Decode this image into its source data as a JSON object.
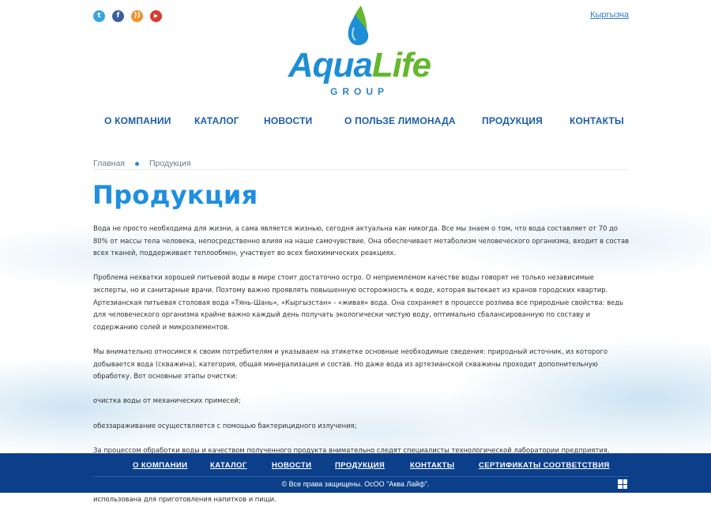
{
  "social": {
    "twitter": {
      "icon": "twitter-icon",
      "glyph": "t"
    },
    "facebook": {
      "icon": "facebook-icon",
      "glyph": "f"
    },
    "rss": {
      "icon": "rss-icon",
      "glyph": "))"
    },
    "youtube": {
      "icon": "youtube-icon",
      "glyph": "▶"
    }
  },
  "language_link": "Кыргызча",
  "logo": {
    "aqua": "Aqua",
    "life": "Life",
    "group": "GROUP"
  },
  "nav": [
    "О КОМПАНИИ",
    "КАТАЛОГ",
    "НОВОСТИ",
    "О ПОЛЬЗЕ ЛИМОНАДА",
    "ПРОДУКЦИЯ",
    "КОНТАКТЫ"
  ],
  "breadcrumb": {
    "home": "Главная",
    "current": "Продукция"
  },
  "page_title": "Продукция",
  "paragraphs": [
    "Вода не просто необходима для жизни, а сама является жизнью, сегодня актуальна как никогда. Все мы знаем о том, что вода составляет от 70 до 80% от массы тела человека, непосредственно влияя на наше самочувствие. Она обеспечивает метаболизм человеческого организма, входит в состав всех тканей, поддерживает теплообмен, участвует во всех биохимических реакциях.",
    "Проблема нехватки хорошей питьевой воды в мире стоит достаточно остро. О неприемлемом качестве воды говорят не только независимые эксперты, но и санитарные врачи. Поэтому важно проявлять повышенную осторожность к воде, которая вытекает из кранов городских квартир. Артезианская питьевая столовая вода «Тянь-Шань», «Кыргызстан» - «живая» вода. Она сохраняет в процессе розлива все природные свойства: ведь для человеческого организма крайне важно каждый день получать экологически чистую воду, оптимально сбалансированную по составу и содержанию солей и микроэлементов.",
    "Мы внимательно относимся к своим потребителям и указываем на этикетке основные необходимые сведения: природный источник, из которого добывается вода (скважина), категория, общая минерализация и состав. Но даже вода из артезианской скважины проходит дополнительную обработку. Вот основные этапы очистки:",
    "очистка воды от механических примесей;",
    "обеззараживание осуществляется с помощью бактерицидного излучения;",
    "За процессом обработки воды и качеством полученного продукта внимательно следят специалисты технологической лаборатории предприятия, которые контролирует весь процесс производства, начиная от скважины, заканчивая розливом в емкости.",
    "Артезианская питьевая столовая вода «Тянь-Шань», «Кыргызстан» отличается приятным вкусом, прекрасно утоляет жажду, может быть использована для приготовления напитков и пищи."
  ],
  "footer": {
    "nav": [
      "О КОМПАНИИ",
      "КАТАЛОГ",
      "НОВОСТИ",
      "ПРОДУКЦИЯ",
      "КОНТАКТЫ",
      "СЕРТИФИКАТЫ СООТВЕТСТВИЯ"
    ],
    "copyright": "© Все права защищены. ОсОО \"Аква Лайф\".",
    "studio_icon": "studio-logo-icon"
  },
  "colors": {
    "accent": "#1f8fe0",
    "nav": "#1b5ea8",
    "footer_bg": "#0c3f8a",
    "logo_green": "#63b82d",
    "logo_blue": "#1d8ed6"
  }
}
